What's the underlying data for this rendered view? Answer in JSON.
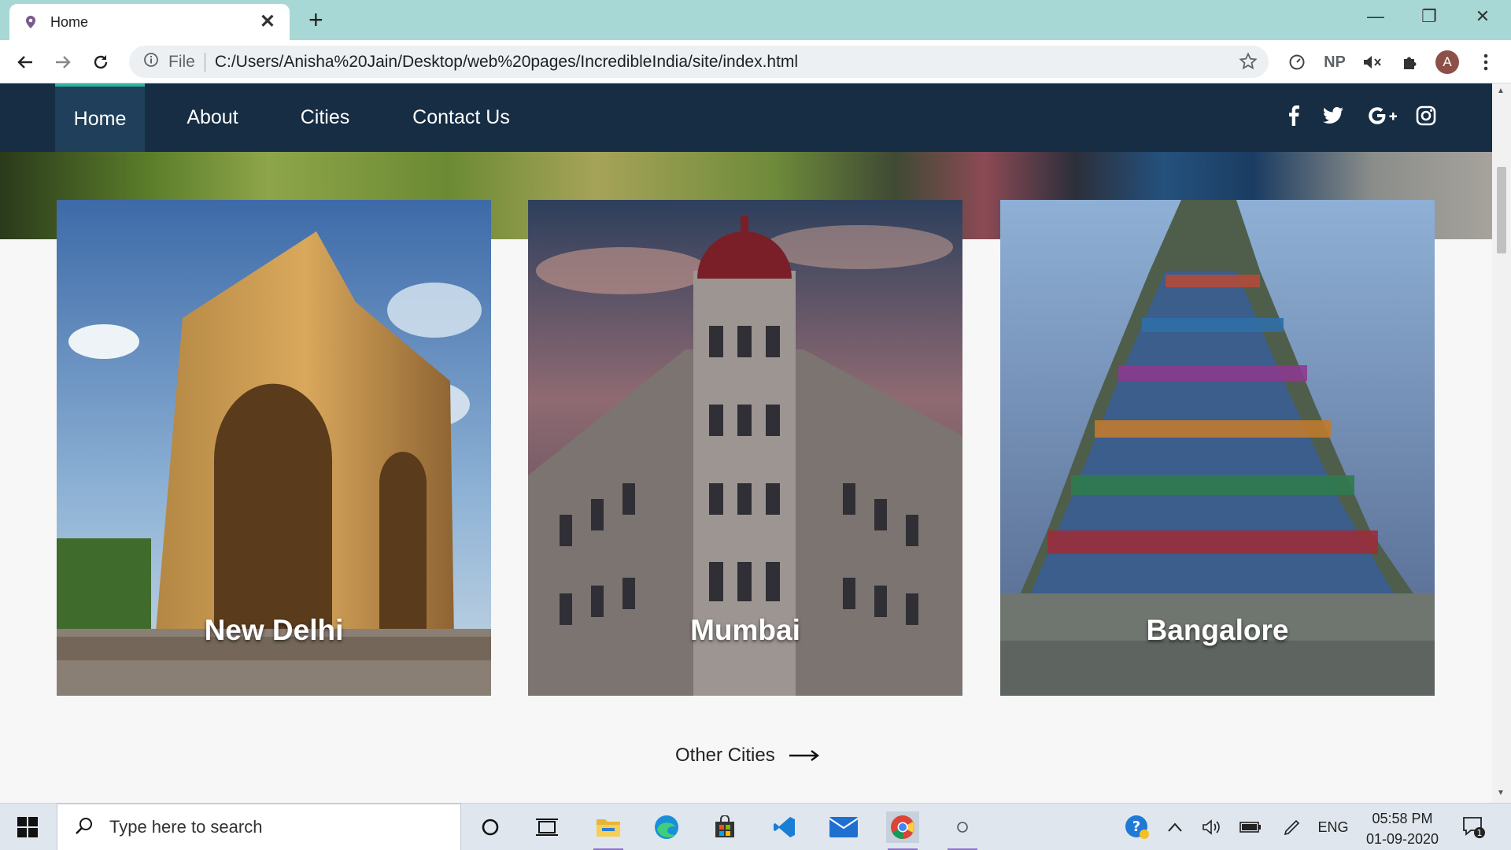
{
  "browser": {
    "tab_title": "Home",
    "omnibox_scheme": "File",
    "url": "C:/Users/Anisha%20Jain/Desktop/web%20pages/IncredibleIndia/site/index.html",
    "extension_np": "NP",
    "profile_initial": "A"
  },
  "navbar": {
    "items": [
      {
        "label": "Home",
        "active": true
      },
      {
        "label": "About",
        "active": false
      },
      {
        "label": "Cities",
        "active": false
      },
      {
        "label": "Contact Us",
        "active": false
      }
    ],
    "social": [
      {
        "name": "facebook-icon",
        "glyph": "f"
      },
      {
        "name": "twitter-icon",
        "glyph": "twitter"
      },
      {
        "name": "google-plus-icon",
        "glyph": "G+"
      },
      {
        "name": "instagram-icon",
        "glyph": "instagram"
      }
    ]
  },
  "cities": {
    "cards": [
      {
        "label": "New Delhi"
      },
      {
        "label": "Mumbai"
      },
      {
        "label": "Bangalore"
      }
    ],
    "other_link": "Other Cities"
  },
  "taskbar": {
    "search_placeholder": "Type here to search",
    "language": "ENG",
    "time": "05:58 PM",
    "date": "01-09-2020",
    "notification_count": "1"
  },
  "colors": {
    "navbar_bg": "#162d44",
    "nav_active_accent": "#2bb3a3",
    "tabbar_bg": "#a8d8d5"
  }
}
